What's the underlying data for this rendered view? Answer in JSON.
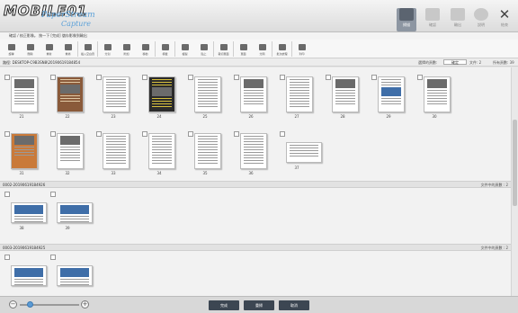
{
  "header": {
    "logo_text": "MOBILE01",
    "logo_small": "fi-6Scan Solution",
    "product_line1": "PaperStream",
    "product_line2": "Capture",
    "buttons": [
      {
        "label": "掃描",
        "icon": "scan-icon",
        "active": true
      },
      {
        "label": "確認",
        "icon": "check-icon",
        "active": false
      },
      {
        "label": "輸出",
        "icon": "output-icon",
        "active": false
      },
      {
        "label": "說明",
        "icon": "info-icon",
        "active": false
      },
      {
        "label": "結束",
        "icon": "close-icon",
        "active": false
      }
    ]
  },
  "breadcrumb": "確認 / 校正影像。 按一下 [完成] 儲存影像到輸出",
  "toolbar": {
    "items": [
      {
        "label": "旋轉",
        "icon": "rotate-icon"
      },
      {
        "label": "刪除",
        "icon": "delete-icon"
      },
      {
        "label": "重新",
        "icon": "redo-icon"
      },
      {
        "label": "重掃",
        "icon": "rescan-icon"
      },
      {
        "label": "插入空白頁",
        "icon": "insert-blank-icon"
      },
      {
        "label": "分割",
        "icon": "split-icon"
      },
      {
        "label": "附加",
        "icon": "append-icon"
      },
      {
        "label": "移動",
        "icon": "move-icon"
      },
      {
        "label": "標籤",
        "icon": "label-icon"
      },
      {
        "label": "複製",
        "icon": "copy-icon"
      },
      {
        "label": "貼上",
        "icon": "paste-icon"
      },
      {
        "label": "裁切頁面",
        "icon": "crop-icon"
      },
      {
        "label": "頁面",
        "icon": "page-icon"
      },
      {
        "label": "分隔",
        "icon": "separator-icon"
      },
      {
        "label": "批次處理",
        "icon": "batch-icon"
      },
      {
        "label": "列印",
        "icon": "print-icon"
      }
    ]
  },
  "pathbar": {
    "path": "路徑: DESKTOP-C9B3SN8\\20190619184854",
    "count_label": "選擇的頁數:",
    "count_value": "0",
    "count_button": "確定",
    "files": "文件: 2",
    "all": "所有頁數: 39"
  },
  "groups": [
    {
      "name": "",
      "pages": [
        {
          "num": "21",
          "style": "mag"
        },
        {
          "num": "22",
          "style": "brown"
        },
        {
          "num": "23",
          "style": "text"
        },
        {
          "num": "24",
          "style": "dark"
        },
        {
          "num": "25",
          "style": "text"
        },
        {
          "num": "26",
          "style": "mag"
        },
        {
          "num": "27",
          "style": "text"
        },
        {
          "num": "28",
          "style": "mag"
        },
        {
          "num": "29",
          "style": "blue"
        },
        {
          "num": "30",
          "style": "mag"
        },
        {
          "num": "31",
          "style": "orange"
        },
        {
          "num": "32",
          "style": "mag"
        },
        {
          "num": "33",
          "style": "text"
        },
        {
          "num": "34",
          "style": "text"
        },
        {
          "num": "35",
          "style": "text"
        },
        {
          "num": "36",
          "style": "text"
        },
        {
          "num": "37",
          "style": "land"
        }
      ]
    },
    {
      "name": "0002-20190619184926",
      "count": "文件中的頁數 : 2",
      "pages": [
        {
          "num": "38",
          "style": "form"
        },
        {
          "num": "39",
          "style": "form"
        }
      ]
    },
    {
      "name": "0003-20190619184925",
      "count": "文件中的頁數 : 2",
      "pages": [
        {
          "num": "",
          "style": "form"
        },
        {
          "num": "",
          "style": "form"
        }
      ]
    }
  ],
  "footer": {
    "zoom_minus": "−",
    "zoom_plus": "+",
    "zoom_fraction": 0.18,
    "buttons": [
      "完成",
      "重掃",
      "取消"
    ]
  }
}
